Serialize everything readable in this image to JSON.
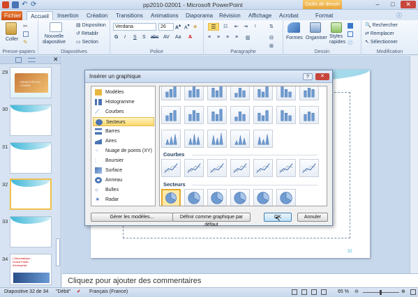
{
  "window": {
    "title": "pp2010-02001 - Microsoft PowerPoint",
    "contextual_tab_group": "Outils de dessin",
    "controls": [
      "–",
      "□",
      "✕"
    ]
  },
  "tabs": [
    "Fichier",
    "Accueil",
    "Insertion",
    "Création",
    "Transitions",
    "Animations",
    "Diaporama",
    "Révision",
    "Affichage",
    "Acrobat",
    "Format"
  ],
  "ribbon": {
    "presse_papiers": {
      "label": "Presse-papiers",
      "coller": "Coller"
    },
    "diapositives": {
      "label": "Diapositives",
      "nouvelle": "Nouvelle\ndiapositive",
      "disposition": "Disposition",
      "retablir": "Rétablir",
      "section": "Section"
    },
    "police": {
      "label": "Police",
      "font": "Verdana",
      "size": "26",
      "buttons": [
        "G",
        "I",
        "S",
        "S",
        "abc",
        "AV",
        "Aa",
        "A"
      ]
    },
    "paragraphe": {
      "label": "Paragraphe"
    },
    "dessin": {
      "label": "Dessin",
      "formes": "Formes",
      "organiser": "Organiser",
      "styles": "Styles\nrapides"
    },
    "modification": {
      "label": "Modification",
      "rechercher": "Rechercher",
      "remplacer": "Remplacer",
      "selectionner": "Sélectionner"
    }
  },
  "slides_panel": {
    "numbers": [
      "29",
      "30",
      "31",
      "32",
      "33",
      "34"
    ],
    "slide29_text": "OBJECTIFS DU COURS",
    "slide34_text": "L'informatique :\nGrand Public\nd'entreprise"
  },
  "slide": {
    "page_number": "32"
  },
  "comments_placeholder": "Cliquez pour ajouter des commentaires",
  "status": {
    "slide": "Diapositive 32 de 34",
    "theme": "\"Débit\"",
    "language": "Français (France)",
    "zoom": "65 %"
  },
  "dialog": {
    "title": "Insérer un graphique",
    "help": "?",
    "categories": [
      "Modèles",
      "Histogramme",
      "Courbes",
      "Secteurs",
      "Barres",
      "Aires",
      "Nuage de points (XY)",
      "Boursier",
      "Surface",
      "Anneau",
      "Bulles",
      "Radar"
    ],
    "selected_category": "Secteurs",
    "section_courbes": "Courbes",
    "section_secteurs": "Secteurs",
    "manage_templates": "Gérer les modèles...",
    "set_default": "Définir comme graphique par défaut",
    "ok": "OK",
    "cancel": "Annuler"
  }
}
